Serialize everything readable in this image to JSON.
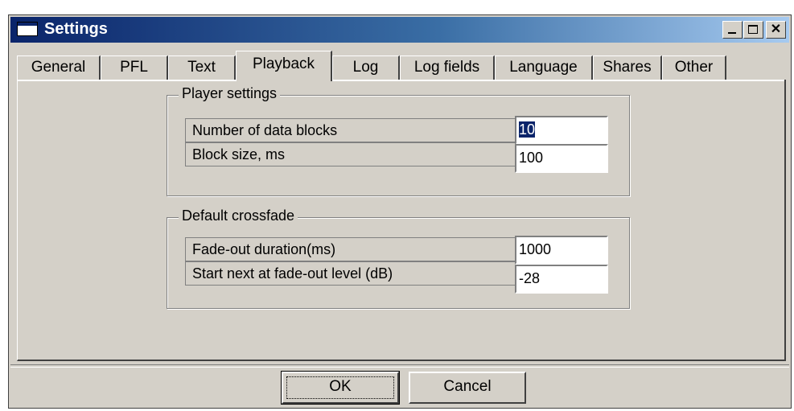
{
  "window": {
    "title": "Settings"
  },
  "tabs": [
    {
      "label": "General"
    },
    {
      "label": "PFL"
    },
    {
      "label": "Text"
    },
    {
      "label": "Playback",
      "active": true
    },
    {
      "label": "Log"
    },
    {
      "label": "Log fields"
    },
    {
      "label": "Language"
    },
    {
      "label": "Shares"
    },
    {
      "label": "Other"
    }
  ],
  "player_settings": {
    "title": "Player settings",
    "rows": [
      {
        "label": "Number of data blocks",
        "value": "10"
      },
      {
        "label": "Block size, ms",
        "value": "100"
      }
    ]
  },
  "crossfade": {
    "title": "Default crossfade",
    "rows": [
      {
        "label": "Fade-out duration(ms)",
        "value": "1000"
      },
      {
        "label": "Start next at fade-out level (dB)",
        "value": "-28"
      }
    ]
  },
  "buttons": {
    "ok": "OK",
    "cancel": "Cancel"
  }
}
